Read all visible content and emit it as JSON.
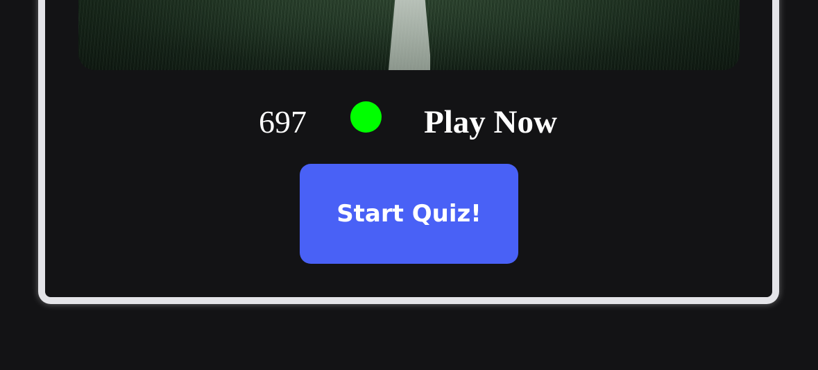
{
  "quiz_card": {
    "hero_image": "football-field-grass",
    "player_count": "697",
    "status_color": "#00ff00",
    "play_label": "Play Now",
    "start_button": {
      "label": "Start Quiz!",
      "color": "#4961f6"
    }
  }
}
